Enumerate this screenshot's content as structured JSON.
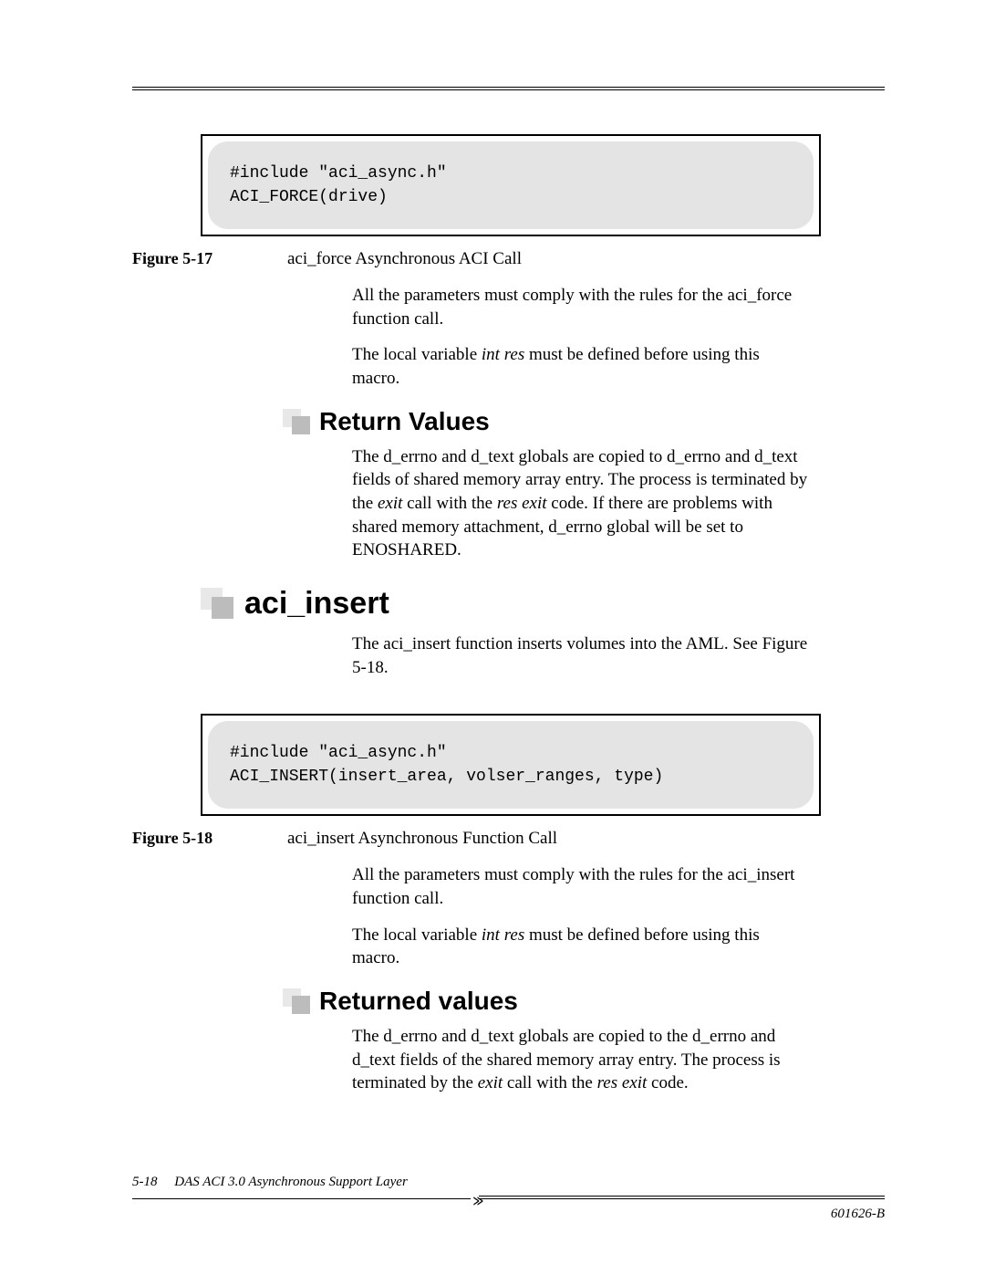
{
  "figures": {
    "f17": {
      "code": "#include \"aci_async.h\"\nACI_FORCE(drive)",
      "label": "Figure 5-17",
      "title": "aci_force Asynchronous ACI Call"
    },
    "f18": {
      "code": "#include \"aci_async.h\"\nACI_INSERT(insert_area, volser_ranges, type)",
      "label": "Figure 5-18",
      "title": "aci_insert Asynchronous Function Call"
    }
  },
  "body": {
    "f17_p1": "All the parameters must comply with the rules for the aci_force function call.",
    "f17_p2a": "The local variable ",
    "f17_p2b": "int res",
    "f17_p2c": " must be defined before using this macro.",
    "rv_h": "Return Values",
    "rv_p_a": "The d_errno and d_text globals are copied to d_errno and d_text fields of shared memory array entry. The process is terminated by the ",
    "rv_p_b": "exit",
    "rv_p_c": " call with the ",
    "rv_p_d": "res exit",
    "rv_p_e": " code. If there are problems with shared memory attachment, d_errno global will be set to ENOSHARED.",
    "aci_insert_h": "aci_insert",
    "ai_p1": "The aci_insert function inserts volumes into the AML. See Figure 5-18.",
    "f18_p1": "All the parameters must comply with the rules for the aci_insert function call.",
    "f18_p2a": "The local variable ",
    "f18_p2b": "int res",
    "f18_p2c": " must be defined before using this macro.",
    "rv2_h": "Returned values",
    "rv2_p_a": "The d_errno and d_text globals are copied to the d_errno and d_text fields of the shared memory array entry. The process is terminated by the ",
    "rv2_p_b": "exit",
    "rv2_p_c": " call with the ",
    "rv2_p_d": "res exit",
    "rv2_p_e": " code."
  },
  "footer": {
    "page": "5-18",
    "doc_title": "DAS ACI 3.0 Asynchronous Support Layer",
    "doc_num": "601626-B"
  }
}
